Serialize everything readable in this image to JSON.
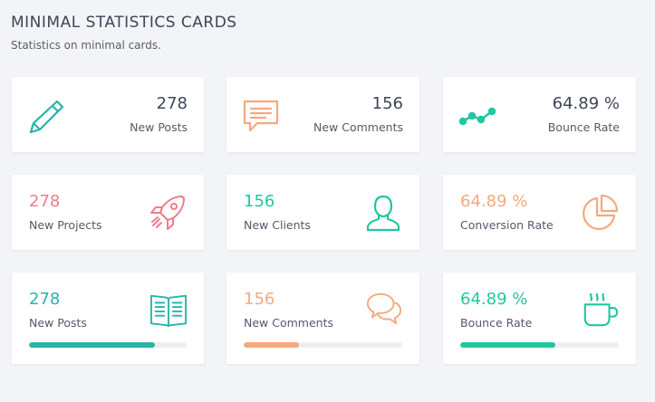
{
  "header": {
    "title": "MINIMAL STATISTICS CARDS",
    "subtitle": "Statistics on minimal cards."
  },
  "colors": {
    "teal": "#28b5a8",
    "orange": "#f6a97e",
    "green": "#21c7a0",
    "pink": "#f07b8b",
    "progress_track": "#eeeeee"
  },
  "row1": [
    {
      "icon": "pencil-icon",
      "value": "278",
      "label": "New Posts"
    },
    {
      "icon": "chat-bubble-icon",
      "value": "156",
      "label": "New Comments"
    },
    {
      "icon": "trend-line-icon",
      "value": "64.89 %",
      "label": "Bounce Rate"
    }
  ],
  "row2": [
    {
      "icon": "rocket-icon",
      "value": "278",
      "label": "New Projects"
    },
    {
      "icon": "user-icon",
      "value": "156",
      "label": "New Clients"
    },
    {
      "icon": "pie-chart-icon",
      "value": "64.89 %",
      "label": "Conversion Rate"
    }
  ],
  "row3": [
    {
      "icon": "book-icon",
      "value": "278",
      "label": "New Posts",
      "progress_percent": 80
    },
    {
      "icon": "chat-bubbles-icon",
      "value": "156",
      "label": "New Comments",
      "progress_percent": 35
    },
    {
      "icon": "coffee-cup-icon",
      "value": "64.89 %",
      "label": "Bounce Rate",
      "progress_percent": 60
    }
  ]
}
